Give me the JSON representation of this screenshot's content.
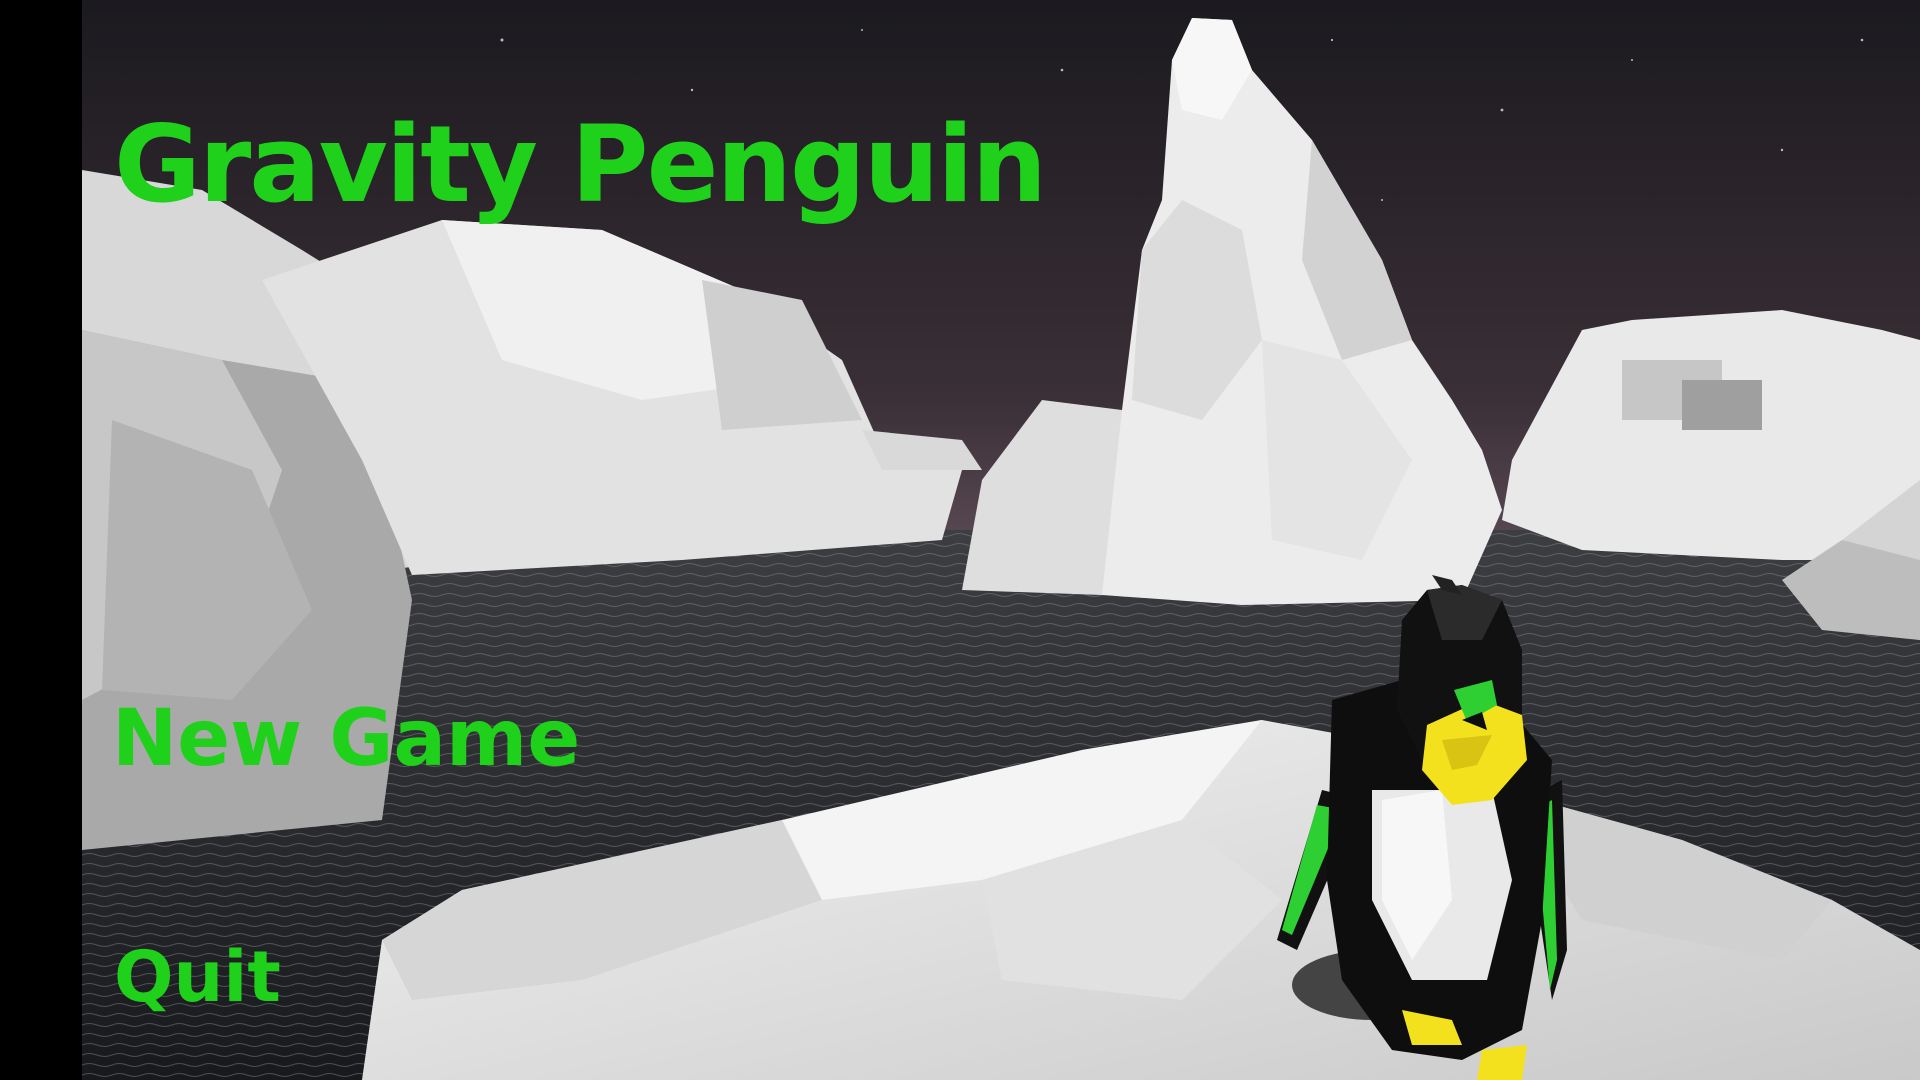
{
  "game": {
    "title": "Gravity Penguin"
  },
  "menu": {
    "items": [
      {
        "id": "new-game",
        "label": "New Game"
      },
      {
        "id": "quit",
        "label": "Quit"
      }
    ]
  },
  "colors": {
    "menu_text": "#1fd11b",
    "sky": "#2a2227",
    "water": "#2d2f33",
    "ice": "#e6e6e6",
    "penguin_beak": "#f3e11d",
    "penguin_accent": "#2ecf33"
  },
  "icons": {
    "scene_subject": "penguin-character"
  }
}
